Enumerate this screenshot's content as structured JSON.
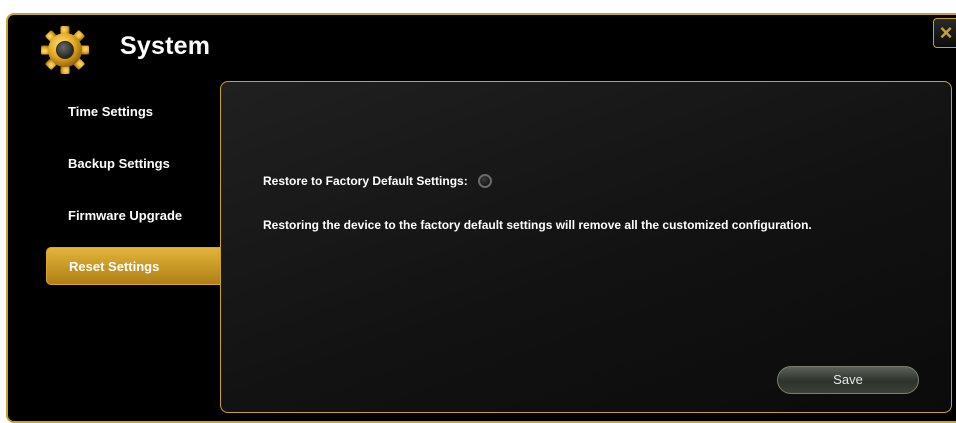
{
  "header": {
    "title": "System",
    "icon": "gear-icon",
    "close_label": "×"
  },
  "sidebar": {
    "items": [
      {
        "label": "Time Settings",
        "active": false
      },
      {
        "label": "Backup Settings",
        "active": false
      },
      {
        "label": "Firmware Upgrade",
        "active": false
      },
      {
        "label": "Reset Settings",
        "active": true
      }
    ]
  },
  "main": {
    "restore_label": "Restore to Factory Default Settings:",
    "restore_description": "Restoring the device to the factory default settings will remove all the customized configuration.",
    "save_label": "Save"
  },
  "colors": {
    "accent": "#c9a227",
    "active_item": "#d4a22b",
    "background": "#000000"
  }
}
